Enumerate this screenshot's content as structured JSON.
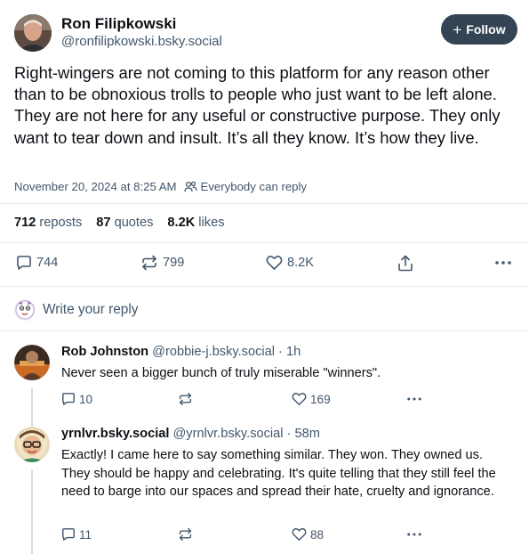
{
  "post": {
    "author_name": "Ron Filipkowski",
    "author_handle": "@ronfilipkowski.bsky.social",
    "follow_label": "Follow",
    "text": "Right-wingers are not coming to this platform for any reason other than to be obnoxious trolls to people who just want to be left alone. They are not here for any useful or constructive purpose. They only want to tear down and insult. It’s all they know. It’s how they live.",
    "timestamp": "November 20, 2024 at 8:25 AM",
    "reply_setting": "Everybody can reply",
    "stats": {
      "reposts_count": "712",
      "reposts_label": "reposts",
      "quotes_count": "87",
      "quotes_label": "quotes",
      "likes_count": "8.2K",
      "likes_label": "likes"
    },
    "actions": {
      "replies": "744",
      "reposts": "799",
      "likes": "8.2K"
    }
  },
  "compose": {
    "placeholder": "Write your reply"
  },
  "comments": [
    {
      "name": "Rob Johnston",
      "handle": "@robbie-j.bsky.social · 1h",
      "text": "Never seen a bigger bunch of truly miserable \"winners\".",
      "replies": "10",
      "likes": "169"
    },
    {
      "name": "yrnlvr.bsky.social",
      "handle": "@yrnlvr.bsky.social · 58m",
      "text": "Exactly! I came here to say something similar. They won. They owned us. They should be happy and celebrating. It's quite telling that they still feel the need to barge into our spaces and spread their hate, cruelty and ignorance.",
      "replies": "11",
      "likes": "88"
    }
  ],
  "icons": {
    "people": "people-icon",
    "reply": "speech-bubble-icon",
    "repost": "repost-arrows-icon",
    "like": "heart-icon",
    "share": "share-icon",
    "more": "ellipsis-icon"
  },
  "colors": {
    "text_primary": "#0b0f14",
    "text_secondary": "#42576c",
    "follow_button": "#354454",
    "divider": "#e4e9ee"
  }
}
